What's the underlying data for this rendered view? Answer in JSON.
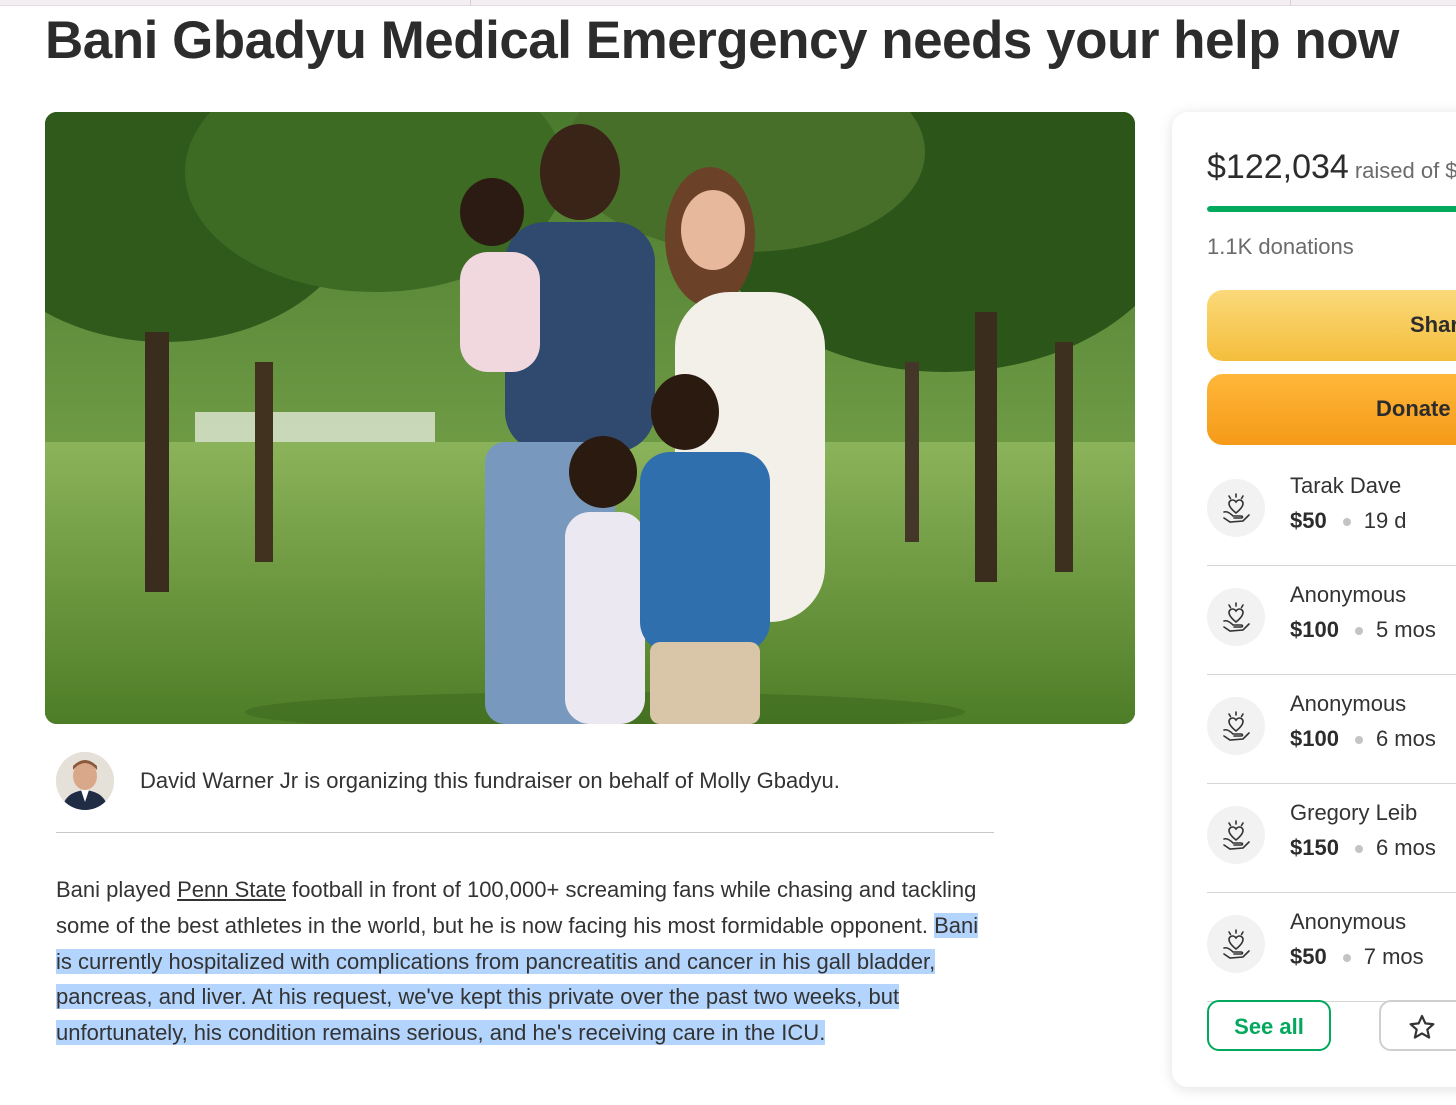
{
  "page": {
    "title": "Bani Gbadyu Medical Emergency needs your help now"
  },
  "organizer": {
    "text": "David Warner Jr is organizing this fundraiser on behalf of Molly Gbadyu."
  },
  "story": {
    "part1": "Bani played ",
    "link": "Penn State",
    "part2": " football in front of 100,000+ screaming fans while chasing and tackling some of the best athletes in the world, but he is now facing his most formidable opponent. ",
    "highlighted": "Bani is currently hospitalized with complications from pancreatitis and cancer in his gall bladder, pancreas, and liver. At his request, we've kept this private over the past two weeks, but unfortunately, his condition remains serious, and he's receiving care in the ICU."
  },
  "donation_panel": {
    "raised_amount": "$122,034",
    "raised_of": "raised of $",
    "progress_fraction": 0.95,
    "donations_count": "1.1K donations",
    "share_label": "Shar",
    "donate_label": "Donate",
    "see_all_label": "See all",
    "top_icon": "star-icon",
    "donor_icon": "heart-hands-icon",
    "accent_color": "#02a95c",
    "donors": [
      {
        "name": "Tarak Dave",
        "amount": "$50",
        "time": "19 d"
      },
      {
        "name": "Anonymous",
        "amount": "$100",
        "time": "5 mos"
      },
      {
        "name": "Anonymous",
        "amount": "$100",
        "time": "6 mos"
      },
      {
        "name": "Gregory Leib",
        "amount": "$150",
        "time": "6 mos"
      },
      {
        "name": "Anonymous",
        "amount": "$50",
        "time": "7 mos"
      }
    ]
  }
}
